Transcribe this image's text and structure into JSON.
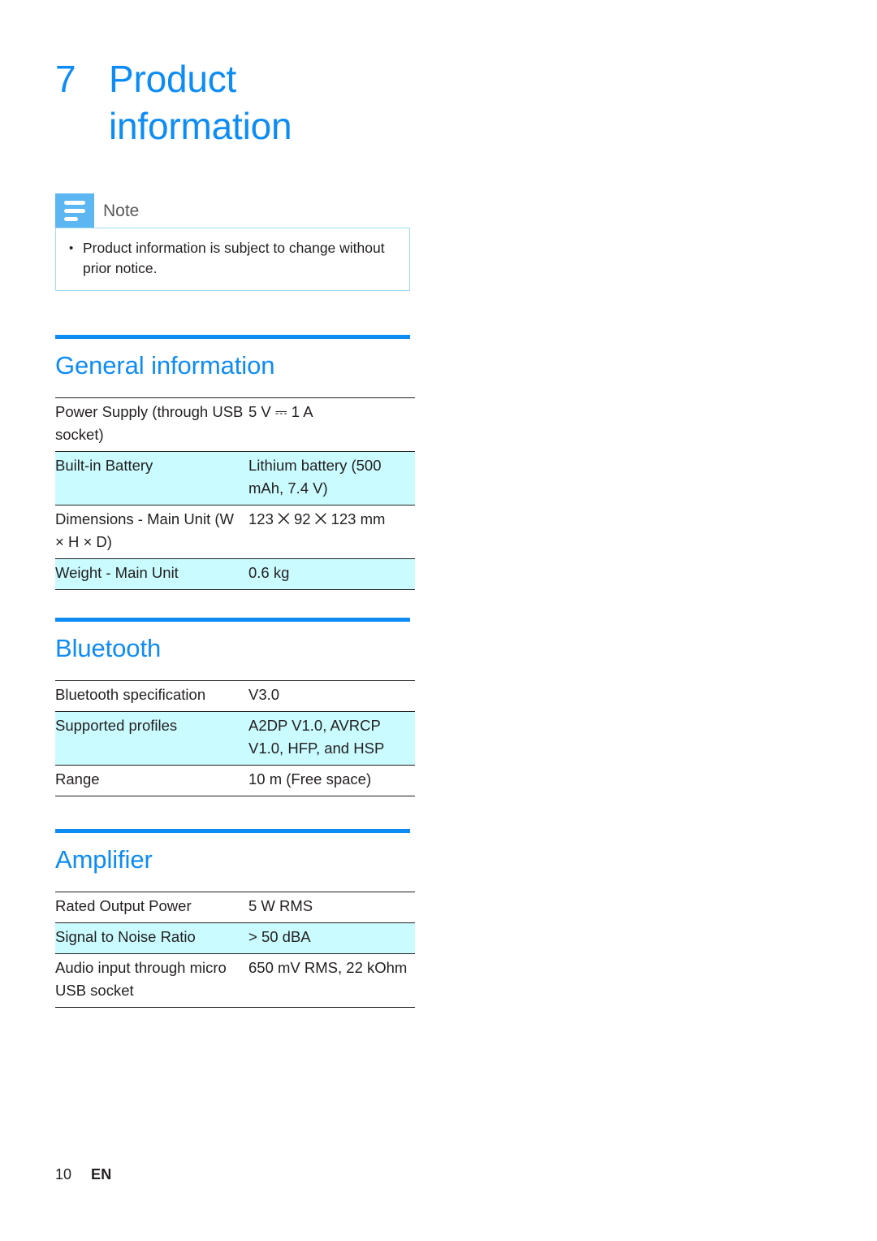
{
  "chapter": {
    "number": "7",
    "title_line1": "Product",
    "title_line2": "information"
  },
  "note": {
    "icon": "note-lines-icon",
    "label": "Note",
    "bullet_glyph": "•",
    "text": "Product information is subject to change without prior notice."
  },
  "sections": [
    {
      "heading": "General information",
      "rows": [
        {
          "key": "Power Supply (through USB socket)",
          "value": "5 V ⎓ 1 A",
          "shaded": false
        },
        {
          "key": "Built-in Battery",
          "value": "Lithium battery (500 mAh, 7.4 V)",
          "shaded": true
        },
        {
          "key": "Dimensions - Main Unit (W × H × D)",
          "value": "123 ⨉ 92 ⨉ 123 mm",
          "shaded": false
        },
        {
          "key": "Weight - Main Unit",
          "value": "0.6 kg",
          "shaded": true
        }
      ]
    },
    {
      "heading": "Bluetooth",
      "rows": [
        {
          "key": "Bluetooth specification",
          "value": "V3.0",
          "shaded": false
        },
        {
          "key": "Supported profiles",
          "value": "A2DP V1.0, AVRCP V1.0, HFP, and HSP",
          "shaded": true
        },
        {
          "key": "Range",
          "value": "10 m (Free space)",
          "shaded": false
        }
      ]
    },
    {
      "heading": "Amplifier",
      "rows": [
        {
          "key": "Rated Output Power",
          "value": "5 W RMS",
          "shaded": false
        },
        {
          "key": "Signal to Noise Ratio",
          "value": "> 50 dBA",
          "shaded": true
        },
        {
          "key": "Audio input through micro USB socket",
          "value": "650 mV RMS, 22 kOhm",
          "shaded": false
        }
      ]
    }
  ],
  "footer": {
    "page_number": "10",
    "language": "EN"
  },
  "colors": {
    "accent_blue": "#0d8cf5",
    "note_icon_blue": "#5cb6f2",
    "note_border_blue": "#9fdcf5",
    "row_shade_cyan": "#c9fbff",
    "text_black": "#231f20",
    "note_label_gray": "#58595b"
  }
}
